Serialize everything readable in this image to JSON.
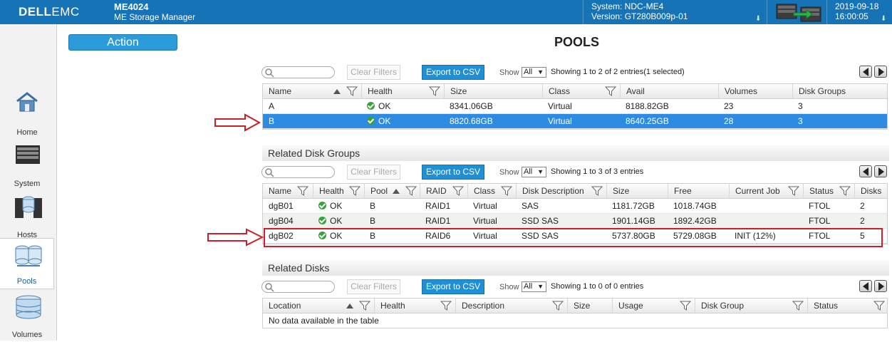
{
  "header": {
    "logo_dell": "DELL",
    "logo_emc": "EMC",
    "model": "ME4024",
    "app_name": "ME Storage Manager",
    "system_line": "System: NDC-ME4",
    "version_line": "Version: GT280B009p-01",
    "date": "2019-09-18",
    "time": "16:00:05"
  },
  "sidebar": {
    "items": [
      {
        "label": "Home"
      },
      {
        "label": "System"
      },
      {
        "label": "Hosts"
      },
      {
        "label": "Pools"
      },
      {
        "label": "Volumes"
      }
    ]
  },
  "action_label": "Action",
  "page_title": "POOLS",
  "controls": {
    "clear_filters": "Clear Filters",
    "export_csv": "Export to CSV",
    "show": "Show",
    "show_value": "All"
  },
  "pools": {
    "showing": "Showing 1 to 2 of 2 entries(1 selected)",
    "columns": [
      "Name",
      "Health",
      "Size",
      "Class",
      "Avail",
      "Volumes",
      "Disk Groups"
    ],
    "rows": [
      [
        "A",
        "OK",
        "8341.06GB",
        "Virtual",
        "8188.82GB",
        "23",
        "3"
      ],
      [
        "B",
        "OK",
        "8820.68GB",
        "Virtual",
        "8640.25GB",
        "28",
        "3"
      ]
    ]
  },
  "disk_groups": {
    "title": "Related Disk Groups",
    "showing": "Showing 1 to 3 of 3 entries",
    "columns": [
      "Name",
      "Health",
      "Pool",
      "RAID",
      "Class",
      "Disk Description",
      "Size",
      "Free",
      "Current Job",
      "Status",
      "Disks"
    ],
    "rows": [
      [
        "dgB01",
        "OK",
        "B",
        "RAID1",
        "Virtual",
        "SAS",
        "1181.72GB",
        "1018.74GB",
        "",
        "FTOL",
        "2"
      ],
      [
        "dgB04",
        "OK",
        "B",
        "RAID1",
        "Virtual",
        "SSD SAS",
        "1901.14GB",
        "1892.42GB",
        "",
        "FTOL",
        "2"
      ],
      [
        "dgB02",
        "OK",
        "B",
        "RAID6",
        "Virtual",
        "SSD SAS",
        "5737.80GB",
        "5729.08GB",
        "INIT (12%)",
        "FTOL",
        "5"
      ]
    ]
  },
  "disks": {
    "title": "Related Disks",
    "showing": "Showing 1 to 0 of 0 entries",
    "columns": [
      "Location",
      "Health",
      "Description",
      "Size",
      "Usage",
      "Disk Group",
      "Status"
    ],
    "empty": "No data available in the table"
  },
  "colors": {
    "header_blue": "#1573b6",
    "selected_row": "#2d8ce2",
    "ok_green": "#35a23c",
    "annotation_red": "#cc1f29"
  }
}
